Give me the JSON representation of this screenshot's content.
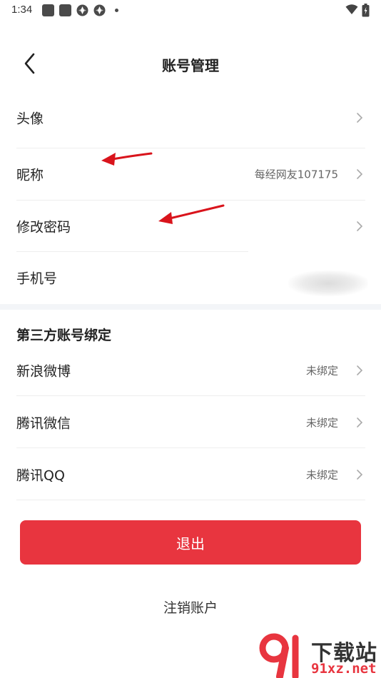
{
  "status_bar": {
    "time": "1:34"
  },
  "header": {
    "title": "账号管理",
    "back_icon": "chevron-left-icon"
  },
  "account_rows": [
    {
      "label": "头像",
      "value": ""
    },
    {
      "label": "昵称",
      "value": "每经网友107175"
    },
    {
      "label": "修改密码",
      "value": ""
    },
    {
      "label": "手机号",
      "value": ""
    }
  ],
  "third_party": {
    "title": "第三方账号绑定",
    "rows": [
      {
        "label": "新浪微博",
        "value": "未绑定"
      },
      {
        "label": "腾讯微信",
        "value": "未绑定"
      },
      {
        "label": "腾讯QQ",
        "value": "未绑定"
      }
    ]
  },
  "actions": {
    "logout_label": "退出",
    "cancel_account_label": "注销账户"
  },
  "watermark": {
    "text": "下载站",
    "domain": "91xz.net"
  },
  "colors": {
    "accent": "#e8353f",
    "section_bg": "#f3f5f8",
    "annotation_arrow": "#d9141c"
  }
}
